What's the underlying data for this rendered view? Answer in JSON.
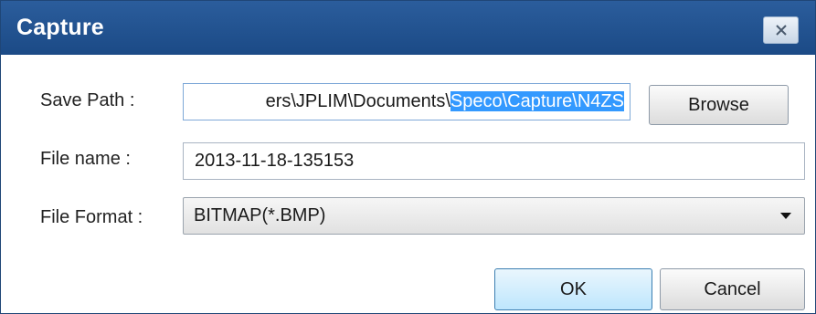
{
  "window": {
    "title": "Capture",
    "close_icon": "close-icon"
  },
  "save_path": {
    "label": "Save Path :",
    "value_unselected": "ers\\JPLIM\\Documents\\",
    "value_selected": "Speco\\Capture\\N4ZS"
  },
  "file_name": {
    "label": "File name :",
    "value": "2013-11-18-135153"
  },
  "file_format": {
    "label": "File Format :",
    "selected": "BITMAP(*.BMP)"
  },
  "buttons": {
    "browse": "Browse",
    "ok": "OK",
    "cancel": "Cancel"
  },
  "colors": {
    "titlebar": "#1b4a86",
    "selection": "#3399ff"
  }
}
